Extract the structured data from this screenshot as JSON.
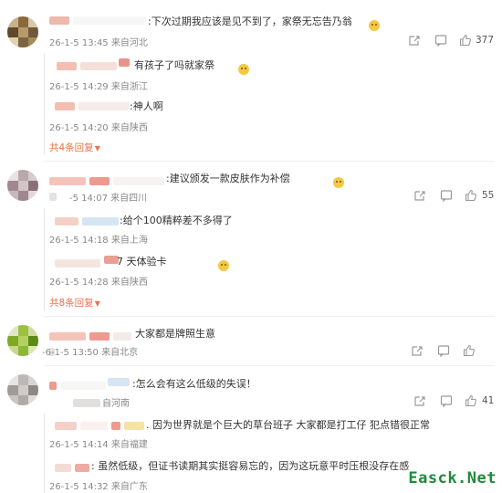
{
  "comments": [
    {
      "text": ":下次过期我应该是见不到了，家祭无忘告乃翁",
      "meta": "26-1-5 13:45 来自河北",
      "like_count": "377",
      "replies": [
        {
          "text": "有孩子了吗就家祭",
          "meta": "26-1-5 14:29 来自浙江"
        },
        {
          "text": ":神人啊",
          "meta": "26-1-5 14:20 来自陕西"
        }
      ],
      "more_label": "共4条回复"
    },
    {
      "text": ":建议颁发一款皮肤作为补偿",
      "meta": "-5 14:07 来自四川",
      "like_count": "55",
      "replies": [
        {
          "text": ":给个100精粹差不多得了",
          "meta": "26-1-5 14:18 来自上海"
        },
        {
          "text": "7 天体验卡",
          "meta": "26-1-5 14:28 来自陕西"
        }
      ],
      "more_label": "共8条回复"
    },
    {
      "text": "大家都是牌照生意",
      "meta": "-6-1-5 13:50 来自北京",
      "like_count": "",
      "replies": []
    },
    {
      "text": ":怎么会有这么低级的失误！",
      "meta": "自河南",
      "like_count": "41",
      "replies": [
        {
          "text": ". 因为世界就是个巨大的草台班子 大家都是打工仔 犯点错很正常",
          "meta": "26-1-5 14:14 来自福建"
        },
        {
          "text": ": 虽然低级，但证书读期其实挺容易忘的，因为这玩意平时压根没存在感",
          "meta": "26-1-5 14:32 来自广东"
        }
      ]
    }
  ],
  "watermark": "Easck.Net",
  "colors": {
    "accent": "#eb7350",
    "meta": "#888888",
    "watermark": "#1e8a3c"
  }
}
